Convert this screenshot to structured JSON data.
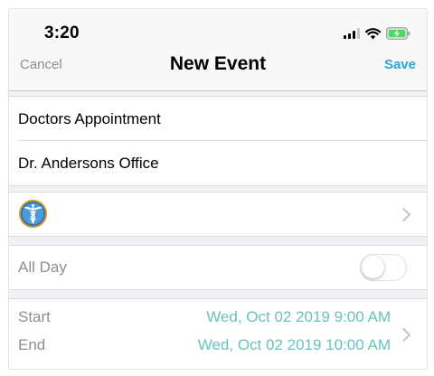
{
  "status_bar": {
    "time": "3:20",
    "icons": [
      "cellular-signal-icon",
      "wifi-icon",
      "battery-charging-icon"
    ]
  },
  "nav": {
    "cancel_label": "Cancel",
    "title": "New Event",
    "save_label": "Save"
  },
  "event": {
    "title": "Doctors Appointment",
    "location": "Dr. Andersons Office",
    "icon": "caduceus-icon",
    "all_day_label": "All Day",
    "all_day_on": false,
    "start_label": "Start",
    "start_value": "Wed, Oct 02 2019 9:00 AM",
    "end_label": "End",
    "end_value": "Wed, Oct 02 2019 10:00 AM"
  },
  "colors": {
    "accent": "#2aa6d6",
    "date_text": "#68c3b9",
    "secondary_text": "#8e8e93",
    "battery_fill": "#4cd964"
  }
}
